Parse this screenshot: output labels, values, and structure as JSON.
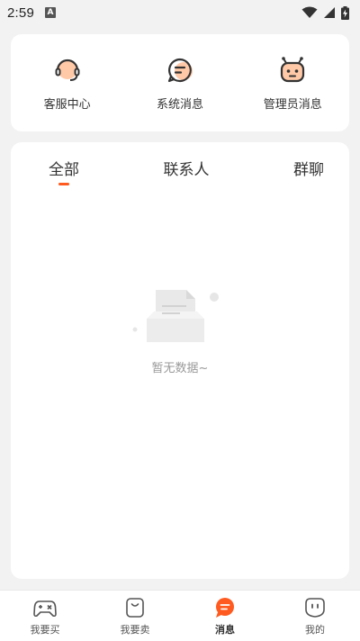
{
  "status_bar": {
    "time": "2:59",
    "notification_icon": "a-icon",
    "wifi_icon": "wifi-icon",
    "signal_icon": "signal-icon",
    "battery_icon": "battery-charging-icon"
  },
  "shortcuts": [
    {
      "label": "客服中心",
      "icon": "headset-icon"
    },
    {
      "label": "系统消息",
      "icon": "chat-bubble-icon"
    },
    {
      "label": "管理员消息",
      "icon": "robot-icon"
    }
  ],
  "tabs": [
    {
      "label": "全部",
      "active": true
    },
    {
      "label": "联系人",
      "active": false
    },
    {
      "label": "群聊",
      "active": false
    }
  ],
  "empty_state": {
    "text": "暂无数据~",
    "icon": "empty-document-icon"
  },
  "bottom_nav": [
    {
      "label": "我要买",
      "icon": "gamepad-icon",
      "active": false
    },
    {
      "label": "我要卖",
      "icon": "bag-icon",
      "active": false
    },
    {
      "label": "消息",
      "icon": "message-icon",
      "active": true
    },
    {
      "label": "我的",
      "icon": "profile-face-icon",
      "active": false
    }
  ],
  "colors": {
    "accent": "#ff5a1f",
    "accent_light": "#ffc9a8",
    "background": "#f2f2f2",
    "card": "#ffffff"
  }
}
